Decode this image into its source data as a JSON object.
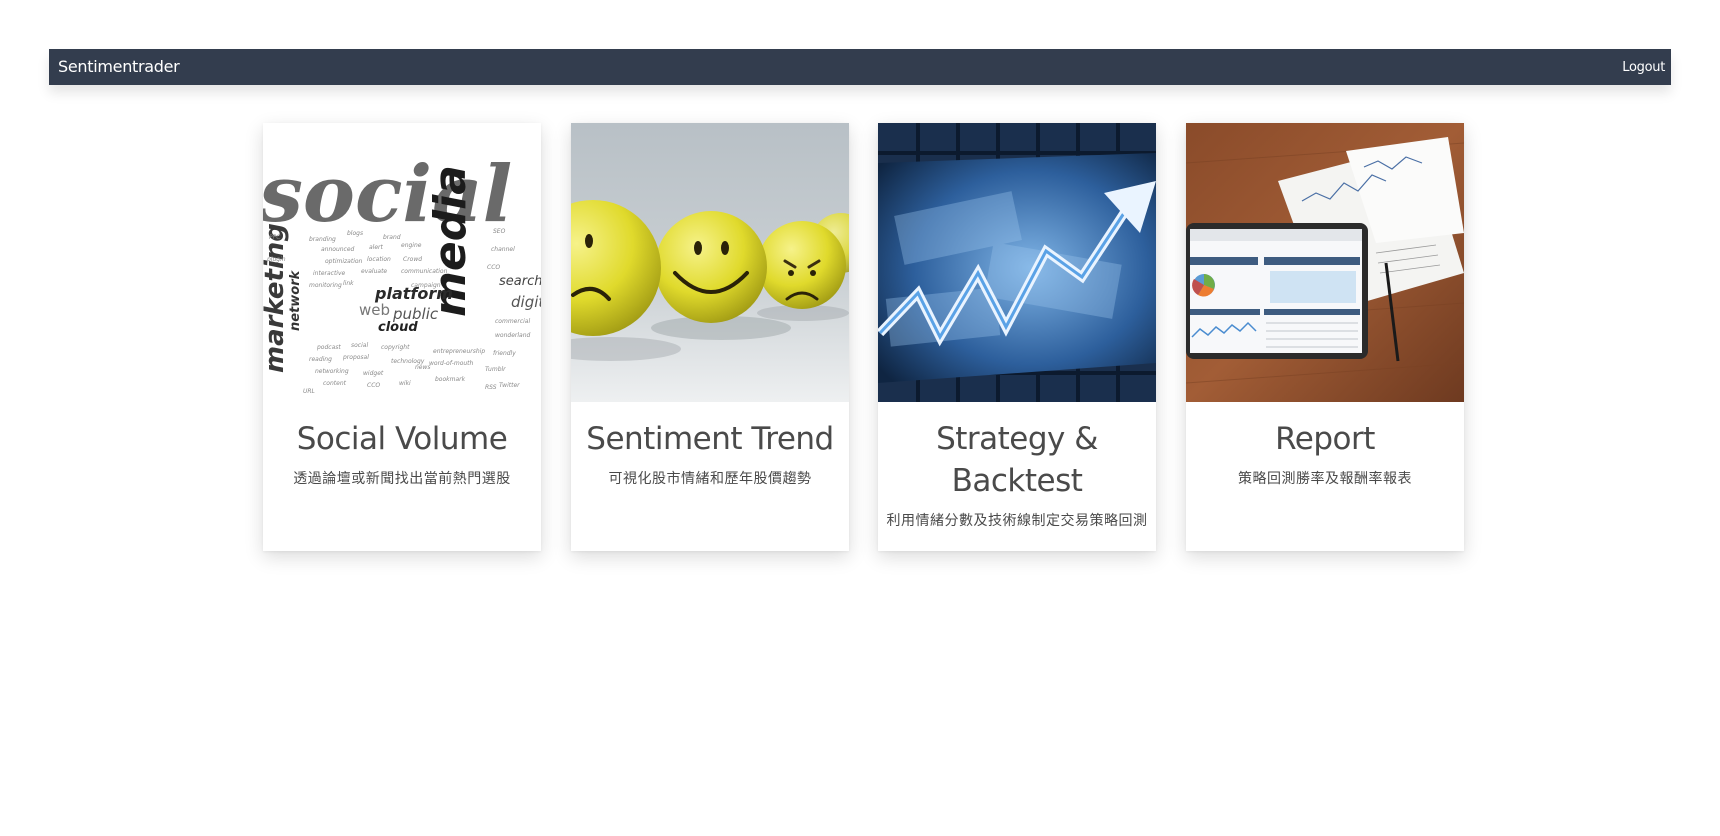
{
  "navbar": {
    "brand": "Sentimentrader",
    "logout_label": "Logout",
    "background": "#333d4e"
  },
  "cards": [
    {
      "title": "Social Volume",
      "description": "透過論壇或新聞找出當前熱門選股",
      "image": "social-media-word-cloud",
      "image_words": [
        "social",
        "media",
        "marketing",
        "platform",
        "public",
        "web",
        "cloud",
        "search",
        "digital",
        "network"
      ]
    },
    {
      "title": "Sentiment Trend",
      "description": "可視化股市情緒和歷年股價趨勢",
      "image": "emoji-balls"
    },
    {
      "title": "Strategy & Backtest",
      "description": "利用情緒分數及技術線制定交易策略回測",
      "image": "currency-chart-arrow"
    },
    {
      "title": "Report",
      "description": "策略回測勝率及報酬率報表",
      "image": "tablet-analytics-report"
    }
  ],
  "colors": {
    "card_text": "#4a4a4a",
    "emoji_yellow": "#e8e23a",
    "page_background": "#ffffff"
  }
}
